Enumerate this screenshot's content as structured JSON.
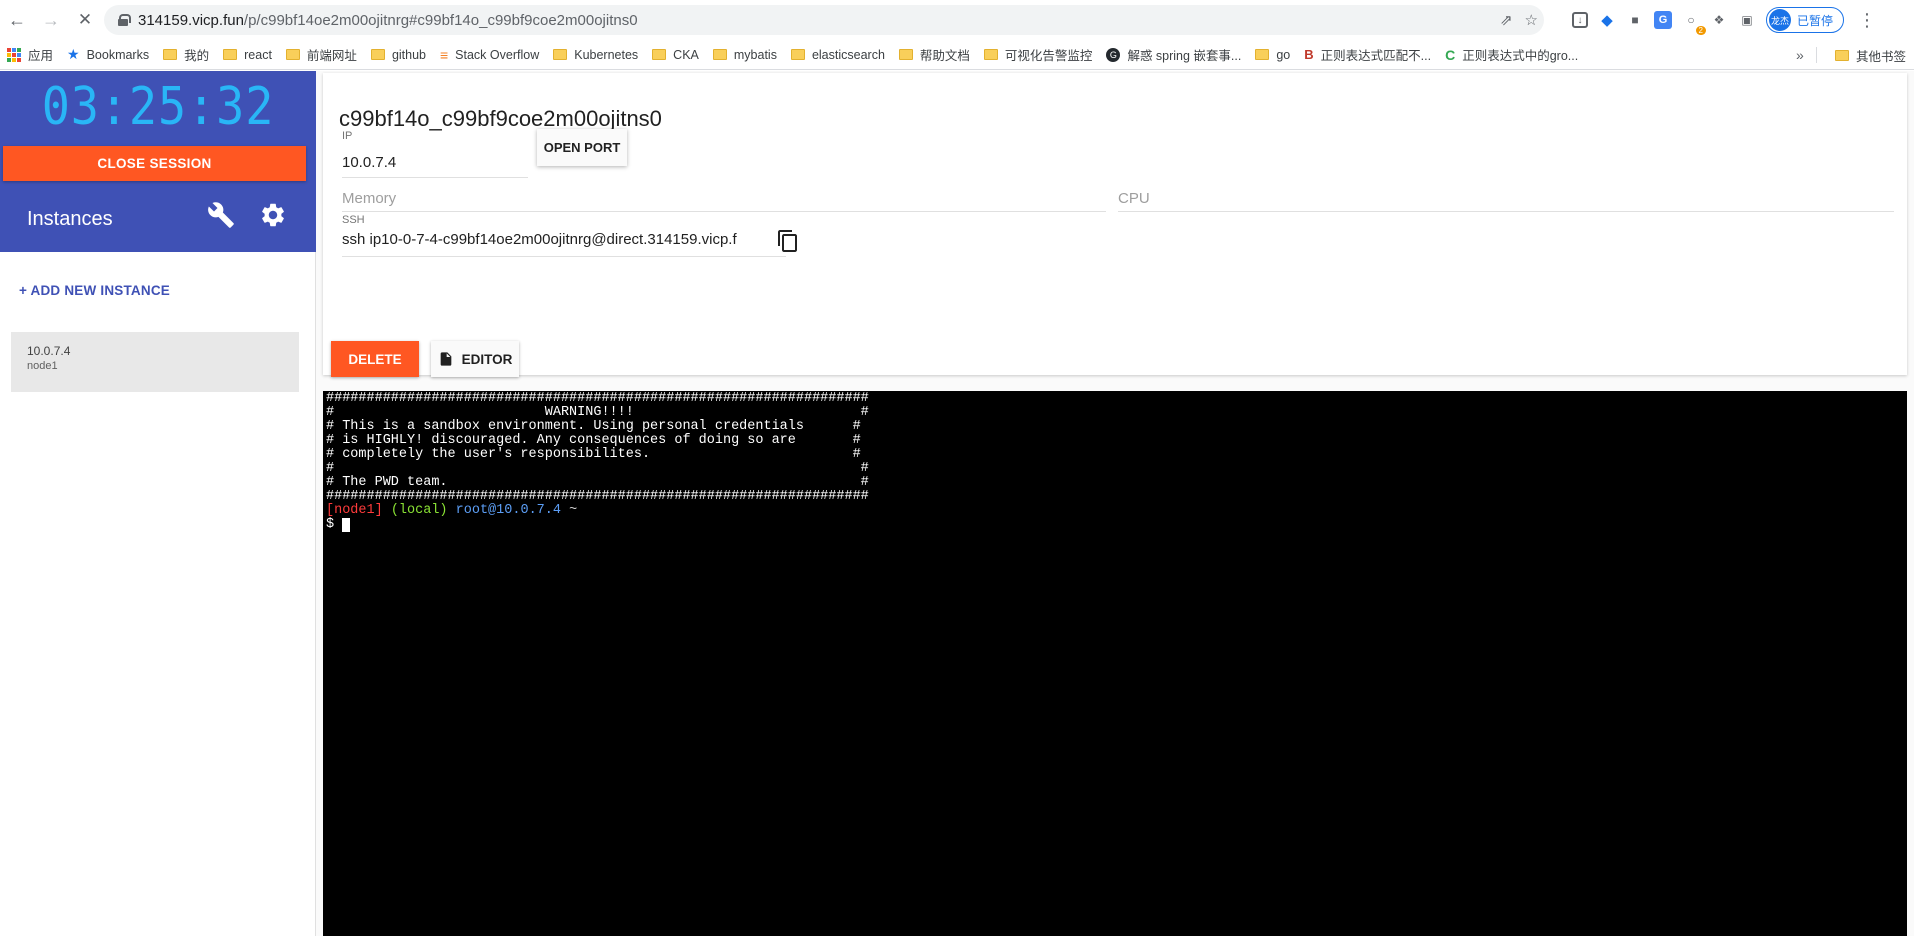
{
  "browser": {
    "url_host": "314159.vicp.fun",
    "url_path": "/p/c99bf14oe2m00ojitnrg#c99bf14o_c99bf9coe2m00ojitns0",
    "profile_label": "已暂停",
    "profile_initials": "龙杰",
    "ext_badge": "2"
  },
  "bookmarks": {
    "items": [
      {
        "label": "应用",
        "icon": "apps-grid-icon"
      },
      {
        "label": "Bookmarks",
        "icon": "star-icon"
      },
      {
        "label": "我的",
        "icon": "folder-icon"
      },
      {
        "label": "react",
        "icon": "folder-icon"
      },
      {
        "label": "前端网址",
        "icon": "folder-icon"
      },
      {
        "label": "github",
        "icon": "folder-icon"
      },
      {
        "label": "Stack Overflow",
        "icon": "stackoverflow-icon"
      },
      {
        "label": "Kubernetes",
        "icon": "folder-icon"
      },
      {
        "label": "CKA",
        "icon": "folder-icon"
      },
      {
        "label": "mybatis",
        "icon": "folder-icon"
      },
      {
        "label": "elasticsearch",
        "icon": "folder-icon"
      },
      {
        "label": "帮助文档",
        "icon": "folder-icon"
      },
      {
        "label": "可视化告警监控",
        "icon": "folder-icon"
      },
      {
        "label": "解惑 spring 嵌套事...",
        "icon": "github-icon"
      },
      {
        "label": "go",
        "icon": "folder-icon"
      },
      {
        "label": "正则表达式匹配不...",
        "icon": "bb-icon"
      },
      {
        "label": "正则表达式中的gro...",
        "icon": "c-icon"
      }
    ],
    "more": "»",
    "other_label": "其他书签"
  },
  "sidebar": {
    "timer": "03:25:32",
    "close_session_label": "CLOSE SESSION",
    "instances_title": "Instances",
    "add_instance_label": "+ ADD NEW INSTANCE",
    "instances": [
      {
        "ip": "10.0.7.4",
        "name": "node1"
      }
    ]
  },
  "instance": {
    "title": "c99bf14o_c99bf9coe2m00ojitns0",
    "ip_label": "IP",
    "ip_value": "10.0.7.4",
    "open_port_label": "OPEN PORT",
    "memory_label": "Memory",
    "cpu_label": "CPU",
    "ssh_label": "SSH",
    "ssh_value": "ssh ip10-0-7-4-c99bf14oe2m00ojitnrg@direct.314159.vicp.f",
    "delete_label": "DELETE",
    "editor_label": "EDITOR"
  },
  "terminal": {
    "banner": "###################################################################\n#                          WARNING!!!!                            #\n# This is a sandbox environment. Using personal credentials      #\n# is HIGHLY! discouraged. Any consequences of doing so are       #\n# completely the user's responsibilites.                         #\n#                                                                 #\n# The PWD team.                                                   #\n###################################################################",
    "prompt_node": "[node1]",
    "prompt_local": "(local)",
    "prompt_user": "root@10.0.7.4",
    "prompt_tilde": "~",
    "prompt_dollar": "$ "
  },
  "colors": {
    "brand": "#3f51b5",
    "accent": "#ff5722",
    "timer": "#29b6f6"
  }
}
